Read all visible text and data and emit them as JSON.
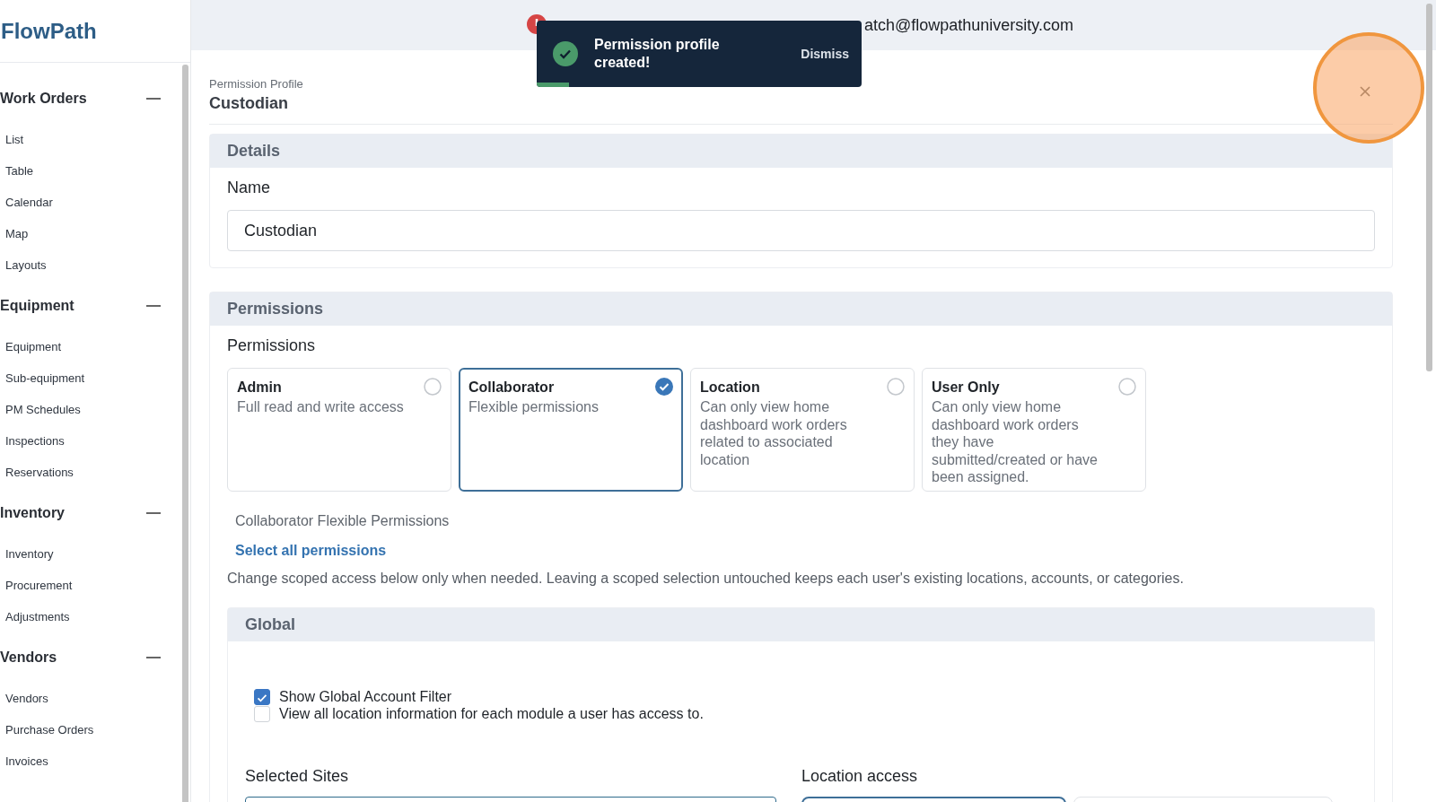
{
  "brand": "FlowPath",
  "sidebar": {
    "groups": [
      {
        "title": "Work Orders",
        "expanded": true,
        "items": [
          "List",
          "Table",
          "Calendar",
          "Map",
          "Layouts"
        ]
      },
      {
        "title": "Equipment",
        "expanded": true,
        "items": [
          "Equipment",
          "Sub-equipment",
          "PM Schedules",
          "Inspections",
          "Reservations"
        ]
      },
      {
        "title": "Inventory",
        "expanded": true,
        "items": [
          "Inventory",
          "Procurement",
          "Adjustments"
        ]
      },
      {
        "title": "Vendors",
        "expanded": true,
        "items": [
          "Vendors",
          "Purchase Orders",
          "Invoices"
        ]
      }
    ]
  },
  "banner": {
    "text": "atch@flowpathuniversity.com"
  },
  "toast": {
    "message": "Permission profile created!",
    "action": "Dismiss",
    "level": 0.1
  },
  "profile": {
    "eyebrow": "Permission Profile",
    "title": "Custodian"
  },
  "details": {
    "heading": "Details",
    "name_label": "Name",
    "name_value": "Custodian"
  },
  "permissions": {
    "heading": "Permissions",
    "label": "Permissions",
    "options": [
      {
        "title": "Admin",
        "description": "Full read and write access",
        "selected": false
      },
      {
        "title": "Collaborator",
        "description": "Flexible permissions",
        "selected": true
      },
      {
        "title": "Location",
        "description": "Can only view home dashboard work orders related to associated location",
        "selected": false
      },
      {
        "title": "User Only",
        "description": "Can only view home dashboard work orders they have submitted/created or have been assigned.",
        "selected": false
      }
    ],
    "flexible_label": "Collaborator Flexible Permissions",
    "select_all": "Select all permissions",
    "note": "Change scoped access below only when needed. Leaving a scoped selection untouched keeps each user's existing locations, accounts, or categories."
  },
  "global": {
    "heading": "Global",
    "checks": [
      {
        "label": "Show Global Account Filter",
        "checked": true
      },
      {
        "label": "View all location information for each module a user has access to.",
        "checked": false
      }
    ],
    "selected_sites_label": "Selected Sites",
    "location_access_label": "Location access"
  }
}
